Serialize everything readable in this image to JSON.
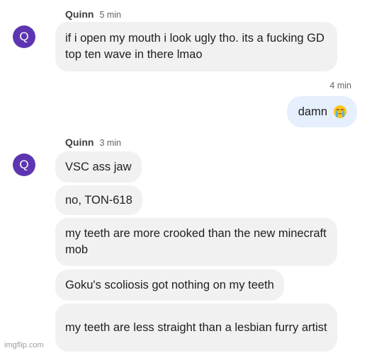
{
  "group1": {
    "sender": "Quinn",
    "time": "5 min",
    "avatar_letter": "Q",
    "messages": [
      "if i open my mouth i look ugly tho. its a fucking GD top ten wave in there lmao"
    ]
  },
  "sent": {
    "time": "4 min",
    "text": "damn",
    "emoji": "loudly-crying-face-icon"
  },
  "group2": {
    "sender": "Quinn",
    "time": "3 min",
    "avatar_letter": "Q",
    "messages": [
      "VSC ass jaw",
      "no, TON-618",
      "my teeth are more crooked than the new minecraft mob",
      "Goku's scoliosis got nothing on my teeth",
      "my teeth are less straight than a lesbian furry artist"
    ]
  },
  "watermark": "imgflip.com",
  "colors": {
    "avatar": "#5e35b1",
    "received_bubble": "#f1f1f1",
    "sent_bubble": "#e5effd"
  }
}
